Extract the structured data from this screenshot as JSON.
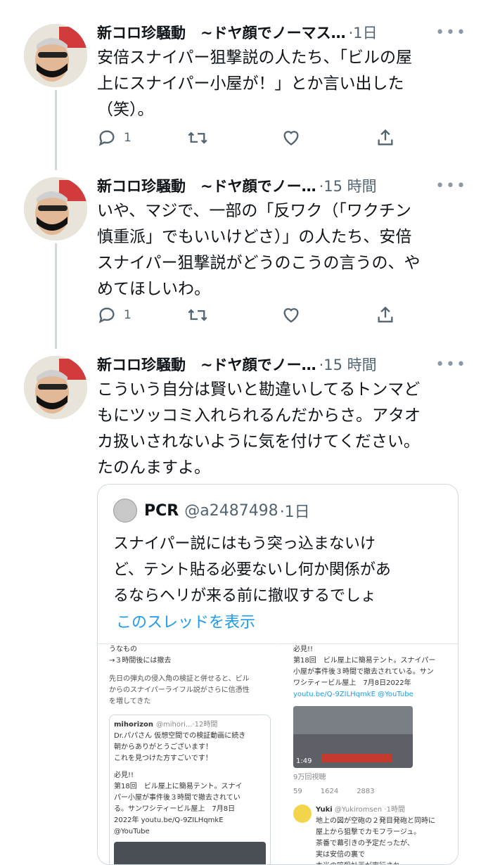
{
  "tweets": [
    {
      "author": "新コロ珍騒動　~ドヤ顔でノーマス…",
      "time": "·1日",
      "text": "安倍スナイパー狙撃説の人たち、「ビルの屋\n上にスナイパー小屋が！」とか言い出した\n（笑）。",
      "reply_count": "1"
    },
    {
      "author": "新コロ珍騒動　~ドヤ顔でノー…",
      "time": "·15 時間",
      "text": "いや、マジで、一部の「反ワク（「ワクチン\n慎重派」でもいいけどさ）」の人たち、安倍\nスナイパー狙撃説がどうのこうの言うの、や\nめてほしいわ。",
      "reply_count": "1"
    },
    {
      "author": "新コロ珍騒動　~ドヤ顔でノー…",
      "time": "·15 時間",
      "text": "こういう自分は賢いと勘違いしてるトンマど\nもにツッコミ入れられるんだからさ。アタオ\nカ扱いされないように気を付けてください。\nたのんますよ。"
    }
  ],
  "more_glyph": "•••",
  "quote": {
    "name": "PCR",
    "handle": "@a2487498",
    "time": "·1日",
    "text": "スナイパー説にはもう突っ込まないけ\nど、テント貼る必要ないし何か関係があ\nるならヘリが来る前に撤収するでしょ",
    "show_thread": "このスレッドを表示"
  },
  "embedded_left": {
    "line1": "うなもの",
    "line2": "→３時間後には撤去",
    "para": "先日の弾丸の侵入角の検証と併せると、ビル\nからのスナイパーライフル説がさらに信憑性\nを増してきた",
    "card_user": "mihorizon",
    "card_handle": "@mihori...",
    "card_time": "·12時間",
    "card_text": "Dr.パパさん 仮想空間での検証動画に続き\n朝からありがとうございます！\nこれを見つけた方すごいです！",
    "card_text2": "必見!!\n第18回　ビル屋上に簡易テント。スナイ\nパー小屋が事件後３時間で撤去されてい\nる。サンワシティービル屋上　7月8日\n2022年 youtu.be/Q-9ZILHqmkE\n@YouTube"
  },
  "embedded_right": {
    "text": "必見!!\n第18回　ビル屋上に簡易テント。スナイパー\n小屋が事件後３時間で撤去されている。サン\nワシティービル屋上　7月8日2022年",
    "link": "youtu.be/Q-9ZILHqmkE @YouTube",
    "video_time": "1:49",
    "views": "9万回視聴",
    "replies": "59",
    "retweets": "1624",
    "likes": "2883",
    "reply_user": "Yuki",
    "reply_handle": "@Yukiromsen",
    "reply_time": "·1時間",
    "reply_text": "地上の図が空砲の２発目発砲と同時に\n屋上から狙撃でカモフラージュ。\n茶番で幕引きの予定だったが、\n実は安倍の裏で\n本当の暗殺計画が実行され"
  }
}
